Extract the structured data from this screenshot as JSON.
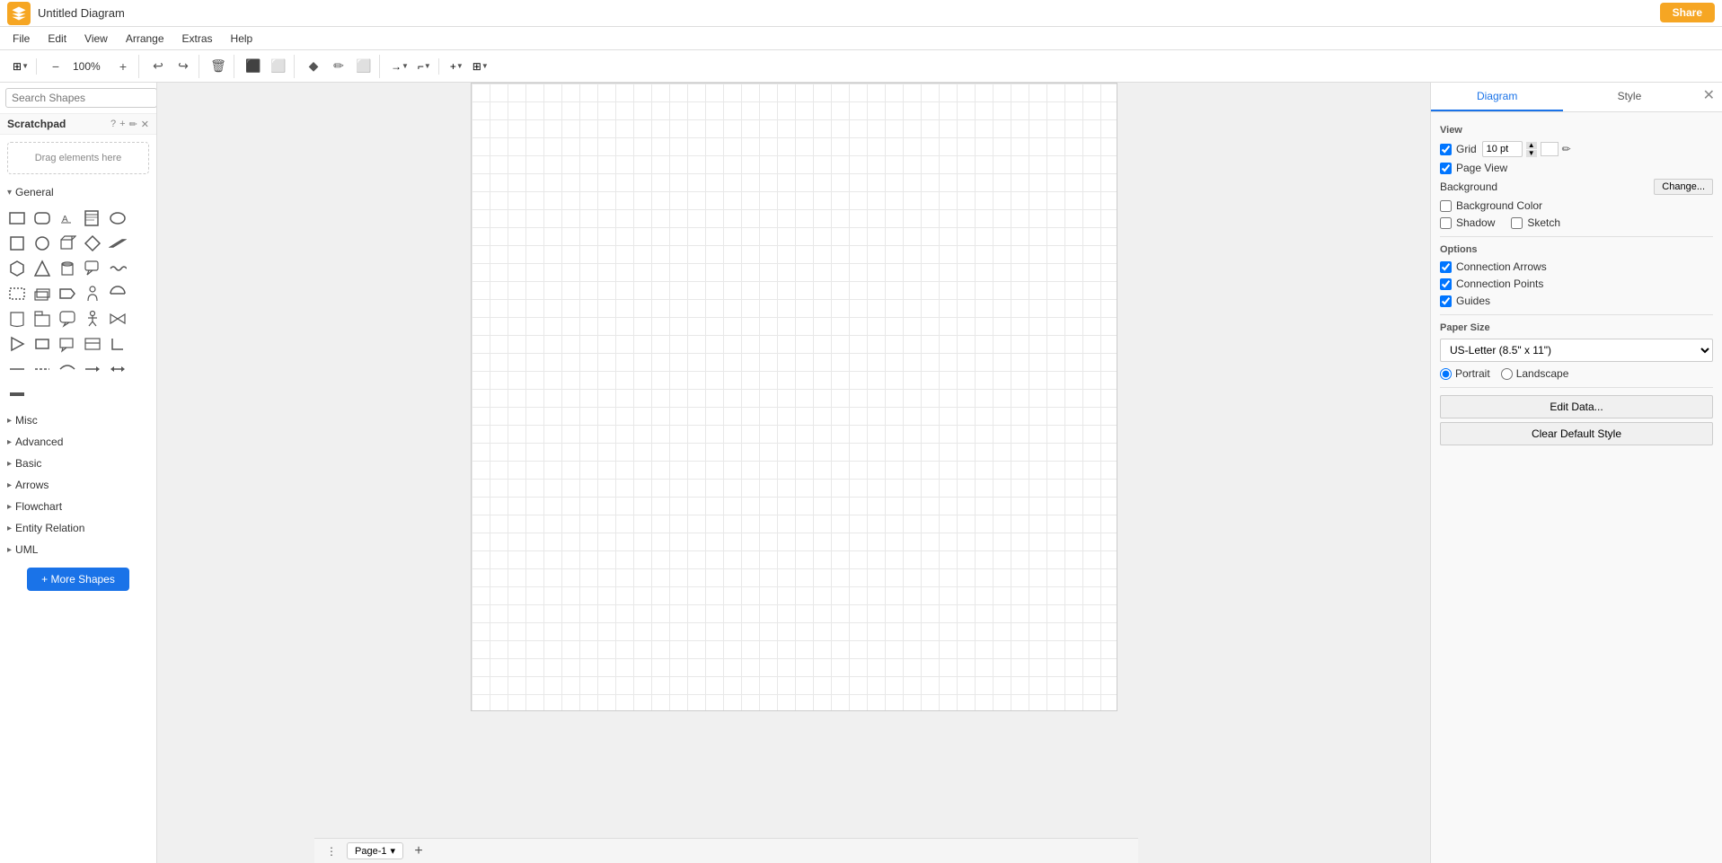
{
  "app": {
    "title": "Untitled Diagram",
    "logo_color": "#f6a623"
  },
  "share_button": {
    "label": "Share"
  },
  "menu": {
    "items": [
      "File",
      "Edit",
      "View",
      "Arrange",
      "Extras",
      "Help"
    ]
  },
  "toolbar": {
    "zoom_label": "100%",
    "view_label": "View"
  },
  "search": {
    "placeholder": "Search Shapes"
  },
  "scratchpad": {
    "label": "Scratchpad",
    "drop_label": "Drag elements here"
  },
  "sections": {
    "general": "General",
    "misc": "Misc",
    "advanced": "Advanced",
    "basic": "Basic",
    "arrows": "Arrows",
    "flowchart": "Flowchart",
    "entity_relation": "Entity Relation",
    "uml": "UML"
  },
  "more_shapes": {
    "label": "+ More Shapes"
  },
  "right_panel": {
    "tabs": [
      "Diagram",
      "Style"
    ],
    "view_section": "View",
    "grid_label": "Grid",
    "grid_value": "10 pt",
    "page_view_label": "Page View",
    "background_label": "Background",
    "change_label": "Change...",
    "background_color_label": "Background Color",
    "shadow_label": "Shadow",
    "sketch_label": "Sketch",
    "options_section": "Options",
    "connection_arrows_label": "Connection Arrows",
    "connection_points_label": "Connection Points",
    "guides_label": "Guides",
    "paper_size_section": "Paper Size",
    "paper_size_value": "US-Letter (8.5\" x 11\")",
    "portrait_label": "Portrait",
    "landscape_label": "Landscape",
    "edit_data_label": "Edit Data...",
    "clear_default_style_label": "Clear Default Style"
  },
  "page": {
    "tab_label": "Page-1"
  }
}
